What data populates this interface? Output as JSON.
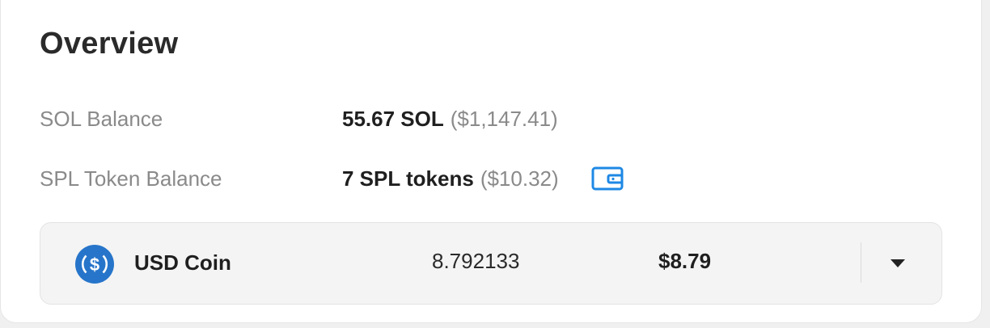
{
  "overview": {
    "title": "Overview",
    "sol_balance": {
      "label": "SOL Balance",
      "amount": "55.67 SOL",
      "usd": "($1,147.41)"
    },
    "spl_balance": {
      "label": "SPL Token Balance",
      "amount": "7 SPL tokens",
      "usd": "($10.32)",
      "action_icon": "wallet-icon"
    },
    "token_row": {
      "icon": "usd-coin-icon",
      "name": "USD Coin",
      "amount": "8.792133",
      "usd_value": "$8.79",
      "expand_icon": "chevron-down-icon"
    }
  },
  "colors": {
    "usdc_blue": "#2775ca",
    "wallet_blue": "#1e88e5",
    "label_gray": "#8a8a8a",
    "text_dark": "#1f1f1f"
  }
}
